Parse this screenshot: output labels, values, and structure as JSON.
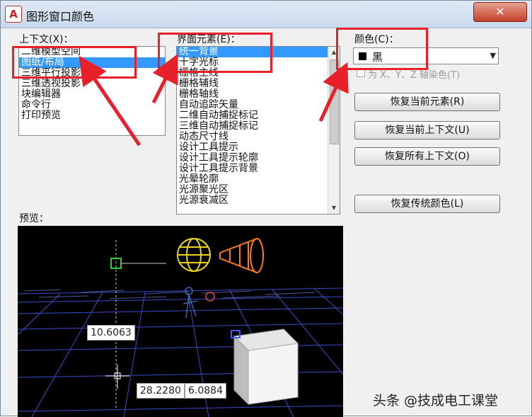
{
  "window": {
    "title": "图形窗口颜色",
    "close_label": "✕"
  },
  "context": {
    "label": "上下文(X)：",
    "items": [
      "二维模型空间",
      "图纸/布局",
      "三维平行投影",
      "三维透视投影",
      "块编辑器",
      "命令行",
      "打印预览"
    ],
    "selected_index": 1
  },
  "elements": {
    "label": "界面元素(E)：",
    "items": [
      "统一背景",
      "十字光标",
      "栅格主线",
      "栅格辅线",
      "栅格轴线",
      "自动追踪矢量",
      "二维自动捕捉标记",
      "三维自动捕捉标记",
      "动态尺寸线",
      "设计工具提示",
      "设计工具提示轮廓",
      "设计工具提示背景",
      "光晕轮廓",
      "光源聚光区",
      "光源衰减区"
    ],
    "selected_index": 0
  },
  "color": {
    "label": "颜色(C)：",
    "value": "黑",
    "swatch": "#000000",
    "tint_label": "为 X、Y、Z 轴染色(T)"
  },
  "buttons": {
    "restore_element": "恢复当前元素(R)",
    "restore_context": "恢复当前上下文(U)",
    "restore_all": "恢复所有上下文(O)",
    "restore_classic": "恢复传统颜色(L)"
  },
  "preview": {
    "label": "预览：",
    "readout_left": "10.6063",
    "readout_bottom_1": "28.2280",
    "readout_bottom_2": "6.0884",
    "background": "#000000",
    "grid_color": "#3a4cc8"
  },
  "annotations": {
    "highlight_color": "#e8202a"
  },
  "watermark": "头条 @技成电工课堂"
}
